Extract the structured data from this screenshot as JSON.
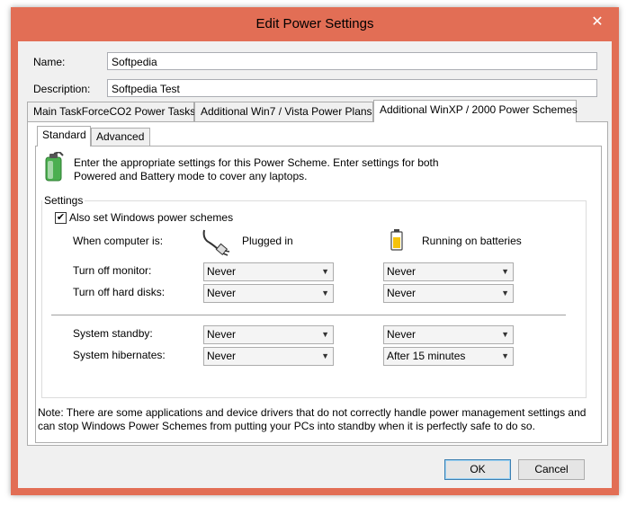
{
  "window": {
    "title": "Edit Power Settings",
    "close_glyph": "✕"
  },
  "form": {
    "name_label": "Name:",
    "name_value": "Softpedia",
    "description_label": "Description:",
    "description_value": "Softpedia Test"
  },
  "tabs": [
    {
      "label": "Main TaskForceCO2 Power Tasks",
      "active": false
    },
    {
      "label": "Additional Win7 / Vista Power Plans",
      "active": false
    },
    {
      "label": "Additional WinXP / 2000 Power Schemes",
      "active": true
    }
  ],
  "subtabs": [
    {
      "label": "Standard",
      "active": true
    },
    {
      "label": "Advanced",
      "active": false
    }
  ],
  "intro": {
    "icon": "battery-plug-icon",
    "line1": "Enter the appropriate settings for this Power Scheme.  Enter settings for both",
    "line2": "Powered and Battery mode to cover any laptops."
  },
  "settings": {
    "group_title": "Settings",
    "also_set_label": "Also set Windows power schemes",
    "also_set_checked": "✔",
    "when_label": "When computer is:",
    "plugged_label": "Plugged in",
    "battery_label": "Running on batteries",
    "rows": [
      {
        "label": "Turn off monitor:",
        "plugged": "Never",
        "battery": "Never"
      },
      {
        "label": "Turn off hard disks:",
        "plugged": "Never",
        "battery": "Never"
      },
      {
        "label": "System standby:",
        "plugged": "Never",
        "battery": "Never"
      },
      {
        "label": "System hibernates:",
        "plugged": "Never",
        "battery": "After 15 minutes"
      }
    ],
    "dropdown_arrow": "▼"
  },
  "note": {
    "line1": "Note: There are some applications and device drivers that do not correctly handle power management settings and",
    "line2": "can stop Windows Power Schemes from putting your PCs into standby when it is perfectly safe to do so."
  },
  "buttons": {
    "ok": "OK",
    "cancel": "Cancel"
  }
}
